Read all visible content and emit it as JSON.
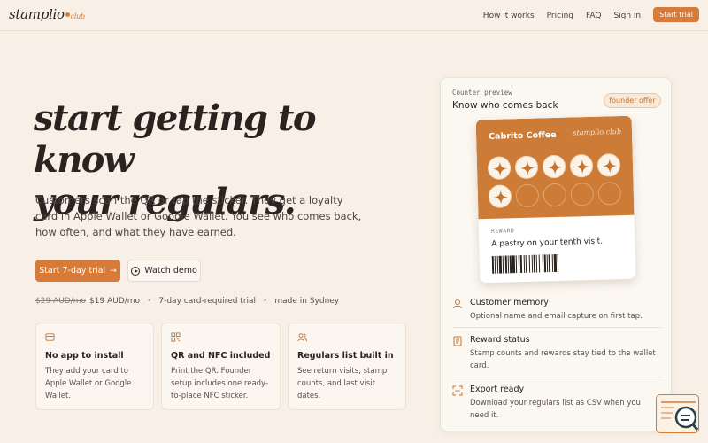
{
  "nav": {
    "logo_main": "stamplio",
    "logo_suffix": "club",
    "links": [
      "How it works",
      "Pricing",
      "FAQ",
      "Sign in"
    ],
    "cta": "Start trial"
  },
  "hero": {
    "title_line1": "start getting to know",
    "title_line2": "your regulars.",
    "description": "Customers scan the QR or tap the sticker. They get a loyalty card in Apple Wallet or Google Wallet. You see who comes back, how often, and what they have earned.",
    "primary_cta": "Start 7-day trial",
    "primary_cta_arrow": "→",
    "secondary_cta": "Watch demo",
    "price_old": "$29 AUD/mo",
    "price_new": "$19 AUD/mo",
    "trial_note": "7-day card-required trial",
    "location_note": "made in Sydney",
    "separator": "•"
  },
  "features": [
    {
      "icon": "wallet-icon",
      "title": "No app to install",
      "desc": "They add your card to Apple Wallet or Google Wallet."
    },
    {
      "icon": "qr-code-icon",
      "title": "QR and NFC included",
      "desc": "Print the QR. Founder setup includes one ready-to-place NFC sticker."
    },
    {
      "icon": "users-icon",
      "title": "Regulars list built in",
      "desc": "See return visits, stamp counts, and last visit dates."
    }
  ],
  "preview": {
    "kicker": "Counter preview",
    "title": "Know who comes back",
    "badge": "founder offer",
    "card": {
      "business_name": "Cabrito Coffee",
      "brand": "stamplio club",
      "stamps_filled": 6,
      "stamps_total": 10,
      "reward_label": "REWARD",
      "reward_text": "A pastry on your tenth visit."
    },
    "items": [
      {
        "icon": "user-icon",
        "title": "Customer memory",
        "desc": "Optional name and email capture on first tap."
      },
      {
        "icon": "receipt-icon",
        "title": "Reward status",
        "desc": "Stamp counts and rewards stay tied to the wallet card."
      },
      {
        "icon": "export-icon",
        "title": "Export ready",
        "desc": "Download your regulars list as CSV when you need it."
      }
    ]
  },
  "colors": {
    "accent": "#d67b3a",
    "background": "#f8f0e6",
    "card_orange": "#cd7c38"
  }
}
